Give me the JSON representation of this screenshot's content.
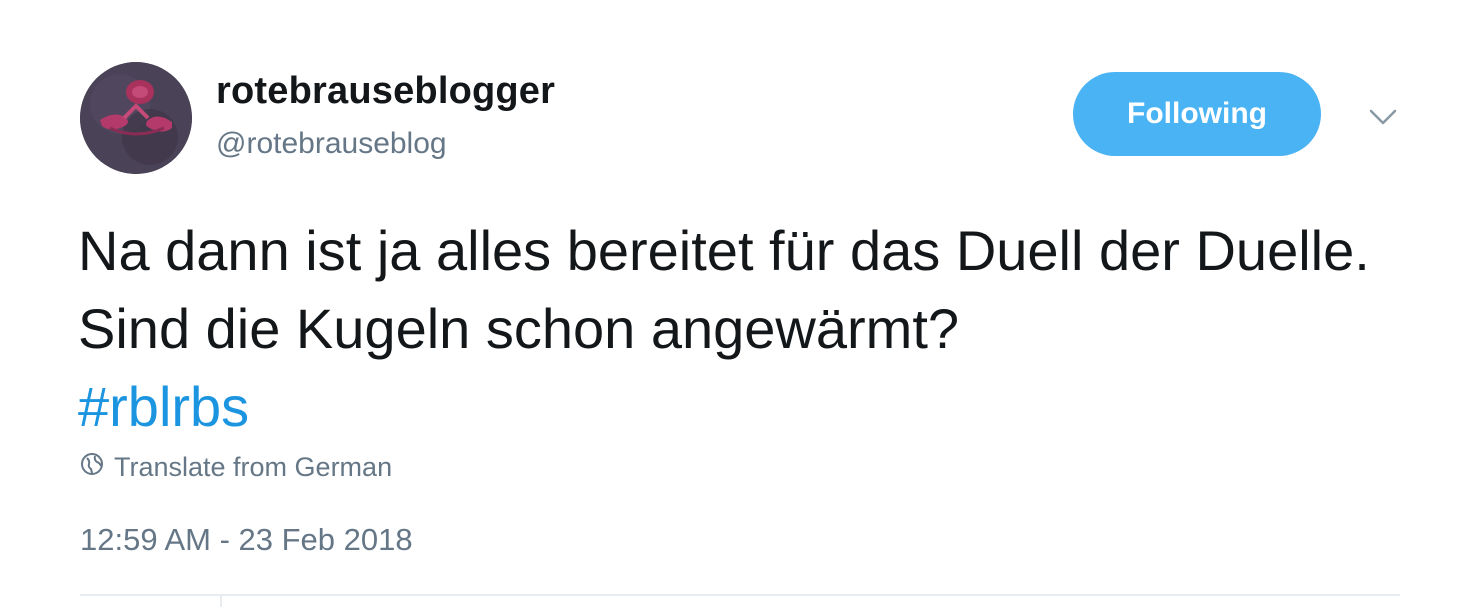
{
  "author": {
    "display_name": "rotebrauseblogger",
    "handle": "@rotebrauseblog",
    "avatar_icon": "knitted-avatar"
  },
  "follow_button": {
    "label": "Following",
    "color": "#4ab3f4"
  },
  "menu_icon": "chevron-down-icon",
  "tweet": {
    "text": "Na dann ist ja alles bereitet für das Duell der Duelle. Sind die Kugeln schon angewärmt?",
    "hashtag": "#rblrbs"
  },
  "translate": {
    "icon": "globe-icon",
    "label": "Translate from German"
  },
  "timestamp": "12:59 AM - 23 Feb 2018",
  "colors": {
    "text": "#14171a",
    "secondary": "#657786",
    "link": "#1b95e0"
  }
}
